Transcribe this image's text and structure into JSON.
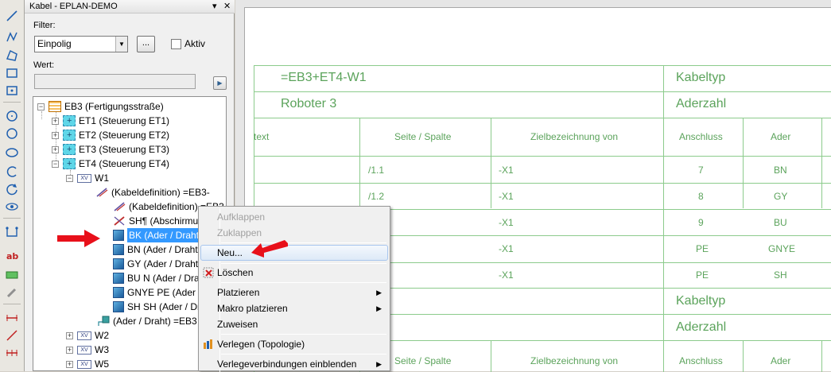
{
  "panel": {
    "title": "Kabel - EPLAN-DEMO",
    "filter_label": "Filter:",
    "filter_value": "Einpolig",
    "filter_more_label": "...",
    "aktiv_label": "Aktiv",
    "wert_label": "Wert:",
    "wert_value": ""
  },
  "tree": {
    "root": "EB3 (Fertigungsstraße)",
    "locations": [
      "ET1 (Steuerung ET1)",
      "ET2 (Steuerung ET2)",
      "ET3 (Steuerung ET3)",
      "ET4 (Steuerung ET4)"
    ],
    "w1": "W1",
    "cable_items": [
      "(Kabeldefinition) =EB3-",
      "(Kabeldefinition) =EB3+ET",
      "SH¶ (Abschirmung",
      "BK (Ader / Draht) =",
      "BN (Ader / Draht) =",
      "GY (Ader / Draht) =",
      "BU N (Ader / Draht)",
      "GNYE PE (Ader / Dra",
      "SH SH (Ader / Drah",
      "(Ader / Draht) =EB3"
    ],
    "siblings": [
      "W2",
      "W3",
      "W5"
    ],
    "xv_badge": "XV"
  },
  "context_menu": {
    "items": [
      {
        "label": "Aufklappen",
        "enabled": false
      },
      {
        "label": "Zuklappen",
        "enabled": false
      },
      {
        "label": "Neu...",
        "enabled": true,
        "highlighted": true
      },
      {
        "label": "Löschen",
        "enabled": true
      },
      {
        "label": "Platzieren",
        "enabled": true,
        "submenu": true
      },
      {
        "label": "Makro platzieren",
        "enabled": true,
        "submenu": true
      },
      {
        "label": "Zuweisen",
        "enabled": true
      },
      {
        "label": "Verlegen (Topologie)",
        "enabled": true
      },
      {
        "label": "Verlegeverbindungen einblenden",
        "enabled": true,
        "submenu": true
      }
    ]
  },
  "sheet": {
    "cable_name": "=EB3+ET4-W1",
    "cable_desc": "Roboter 3",
    "kabeltyp": "Kabeltyp",
    "aderzahl": "Aderzahl",
    "headers": [
      "text",
      "Seite / Spalte",
      "Zielbezeichnung von",
      "Anschluss",
      "Ader"
    ],
    "rows": [
      {
        "seite": "/1.1",
        "ziel": "-X1",
        "anschluss": "7",
        "ader": "BN"
      },
      {
        "seite": "/1.2",
        "ziel": "-X1",
        "anschluss": "8",
        "ader": "GY"
      },
      {
        "seite": "",
        "ziel": "-X1",
        "anschluss": "9",
        "ader": "BU"
      },
      {
        "seite": "",
        "ziel": "-X1",
        "anschluss": "PE",
        "ader": "GNYE"
      },
      {
        "seite": "",
        "ziel": "-X1",
        "anschluss": "PE",
        "ader": "SH"
      }
    ],
    "kabeltyp2": "Kabeltyp",
    "aderzahl2": "Aderzahl",
    "headers2": [
      "Seite / Spalte",
      "Zielbezeichnung von",
      "Anschluss",
      "Ader"
    ]
  },
  "colors": {
    "grid": "#8ccb8c",
    "sheet_text": "#5ba35b",
    "selection": "#3399ff",
    "arrow": "#e8101a"
  }
}
